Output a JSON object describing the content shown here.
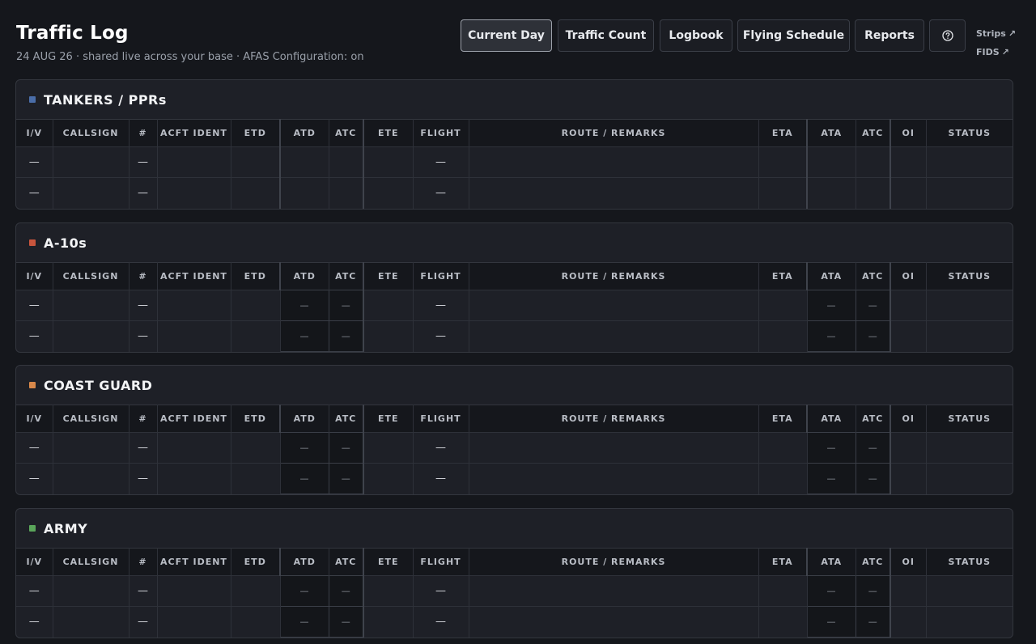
{
  "header": {
    "title": "Traffic Log",
    "subtitle": "24 AUG 26 · shared live across your base · AFAS Configuration: on"
  },
  "nav": [
    {
      "label": "Current Day",
      "active": true
    },
    {
      "label": "Traffic Count",
      "active": false
    },
    {
      "label": "Logbook",
      "active": false
    },
    {
      "label": "Flying Schedule",
      "active": false
    },
    {
      "label": "Reports",
      "active": false
    }
  ],
  "help_icon": "question-circle-icon",
  "links": {
    "strips": "Strips",
    "fids": "FIDS",
    "arrow": "↗"
  },
  "columns": [
    "I/V",
    "CALLSIGN",
    "#",
    "ACFT IDENT",
    "ETD",
    "ATD",
    "ATC",
    "ETE",
    "FLIGHT",
    "ROUTE / REMARKS",
    "ETA",
    "ATA",
    "ATC",
    "OI",
    "STATUS"
  ],
  "panels": [
    {
      "title": "TANKERS / PPRs",
      "color": "#4a6da8",
      "rows": [
        [
          "—",
          "",
          "—",
          "",
          "",
          "",
          "",
          "",
          "—",
          "",
          "",
          "",
          "",
          "",
          ""
        ],
        [
          "—",
          "",
          "—",
          "",
          "",
          "",
          "",
          "",
          "—",
          "",
          "",
          "",
          "",
          "",
          ""
        ]
      ],
      "boxed": false
    },
    {
      "title": "A-10s",
      "color": "#c8553d",
      "rows": [
        [
          "—",
          "",
          "—",
          "",
          "",
          "—",
          "—",
          "",
          "—",
          "",
          "",
          "—",
          "—",
          "",
          ""
        ],
        [
          "—",
          "",
          "—",
          "",
          "",
          "—",
          "—",
          "",
          "—",
          "",
          "",
          "—",
          "—",
          "",
          ""
        ]
      ],
      "boxed": true
    },
    {
      "title": "COAST GUARD",
      "color": "#d9884a",
      "rows": [
        [
          "—",
          "",
          "—",
          "",
          "",
          "—",
          "—",
          "",
          "—",
          "",
          "",
          "—",
          "—",
          "",
          ""
        ],
        [
          "—",
          "",
          "—",
          "",
          "",
          "—",
          "—",
          "",
          "—",
          "",
          "",
          "—",
          "—",
          "",
          ""
        ]
      ],
      "boxed": true
    },
    {
      "title": "ARMY",
      "color": "#5aa55a",
      "rows": [
        [
          "—",
          "",
          "—",
          "",
          "",
          "—",
          "—",
          "",
          "—",
          "",
          "",
          "—",
          "—",
          "",
          ""
        ],
        [
          "—",
          "",
          "—",
          "",
          "",
          "—",
          "—",
          "",
          "—",
          "",
          "",
          "—",
          "—",
          "",
          ""
        ]
      ],
      "boxed": true
    }
  ]
}
